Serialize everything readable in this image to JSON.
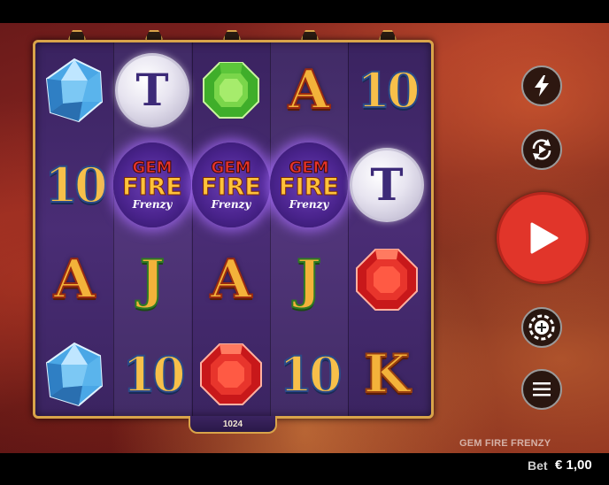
{
  "game": {
    "title": "GEM FIRE FRENZY",
    "ways": "1024"
  },
  "reels": [
    [
      "blue-diamond",
      "10",
      "A",
      "blue-diamond"
    ],
    [
      "hammer",
      "wild",
      "J",
      "10"
    ],
    [
      "emerald",
      "wild",
      "A",
      "ruby"
    ],
    [
      "A",
      "wild",
      "J",
      "10"
    ],
    [
      "10",
      "hammer",
      "ruby",
      "K"
    ]
  ],
  "wild_logo": {
    "line1": "GEM",
    "line2": "FIRE",
    "line3": "Frenzy"
  },
  "controls": {
    "turbo": "lightning-icon",
    "autoplay": "autoplay-icon",
    "spin": "play-icon",
    "bet": "chip-icon",
    "menu": "hamburger-icon"
  },
  "footer": {
    "bet_label": "Bet",
    "bet_value": "€ 1,00"
  },
  "colors": {
    "spin_button": "#e1352a",
    "frame_gold": "#d9a44a",
    "reel_purple": "#4a2d75"
  }
}
